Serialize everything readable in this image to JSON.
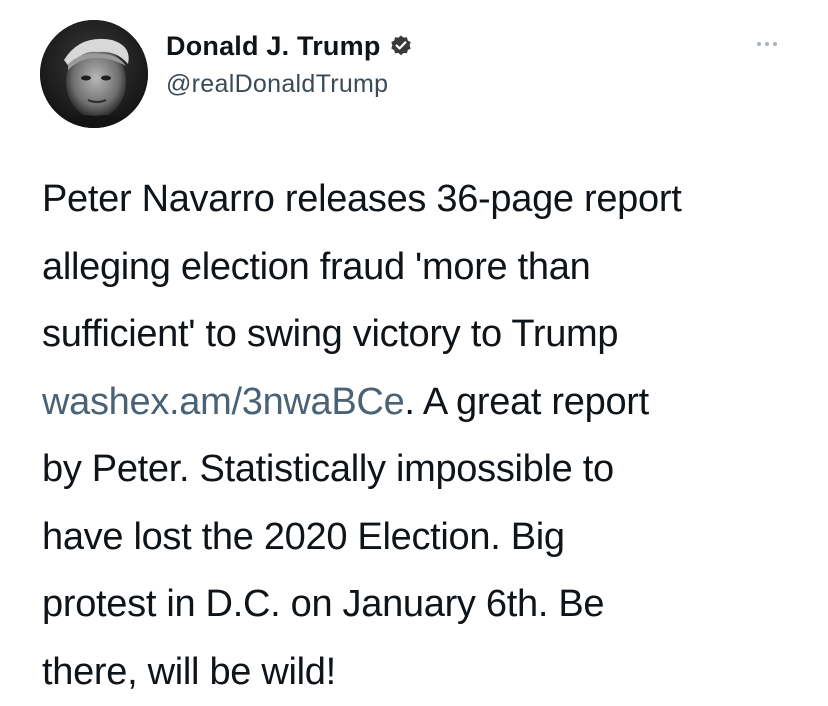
{
  "tweet": {
    "author": {
      "display_name": "Donald J. Trump",
      "handle": "@realDonaldTrump",
      "verified_icon": "verified-badge-icon",
      "avatar_icon": "profile-photo"
    },
    "more_menu_icon": "more-options-icon",
    "text": {
      "line1": "Peter Navarro releases 36-page report",
      "line2": "alleging election fraud 'more than",
      "line3": "sufficient' to swing victory to Trump",
      "link": "washex.am/3nwaBCe",
      "after_link": ". A great report",
      "line5": "by Peter. Statistically impossible to",
      "line6": "have lost the 2020 Election. Big",
      "line7": "protest in D.C. on January 6th. Be",
      "line8": "there, will be wild!"
    },
    "colors": {
      "link": "#4a6275",
      "text": "#0f1419",
      "handle": "#3b4a55",
      "verified": "#3a3a3a"
    }
  }
}
